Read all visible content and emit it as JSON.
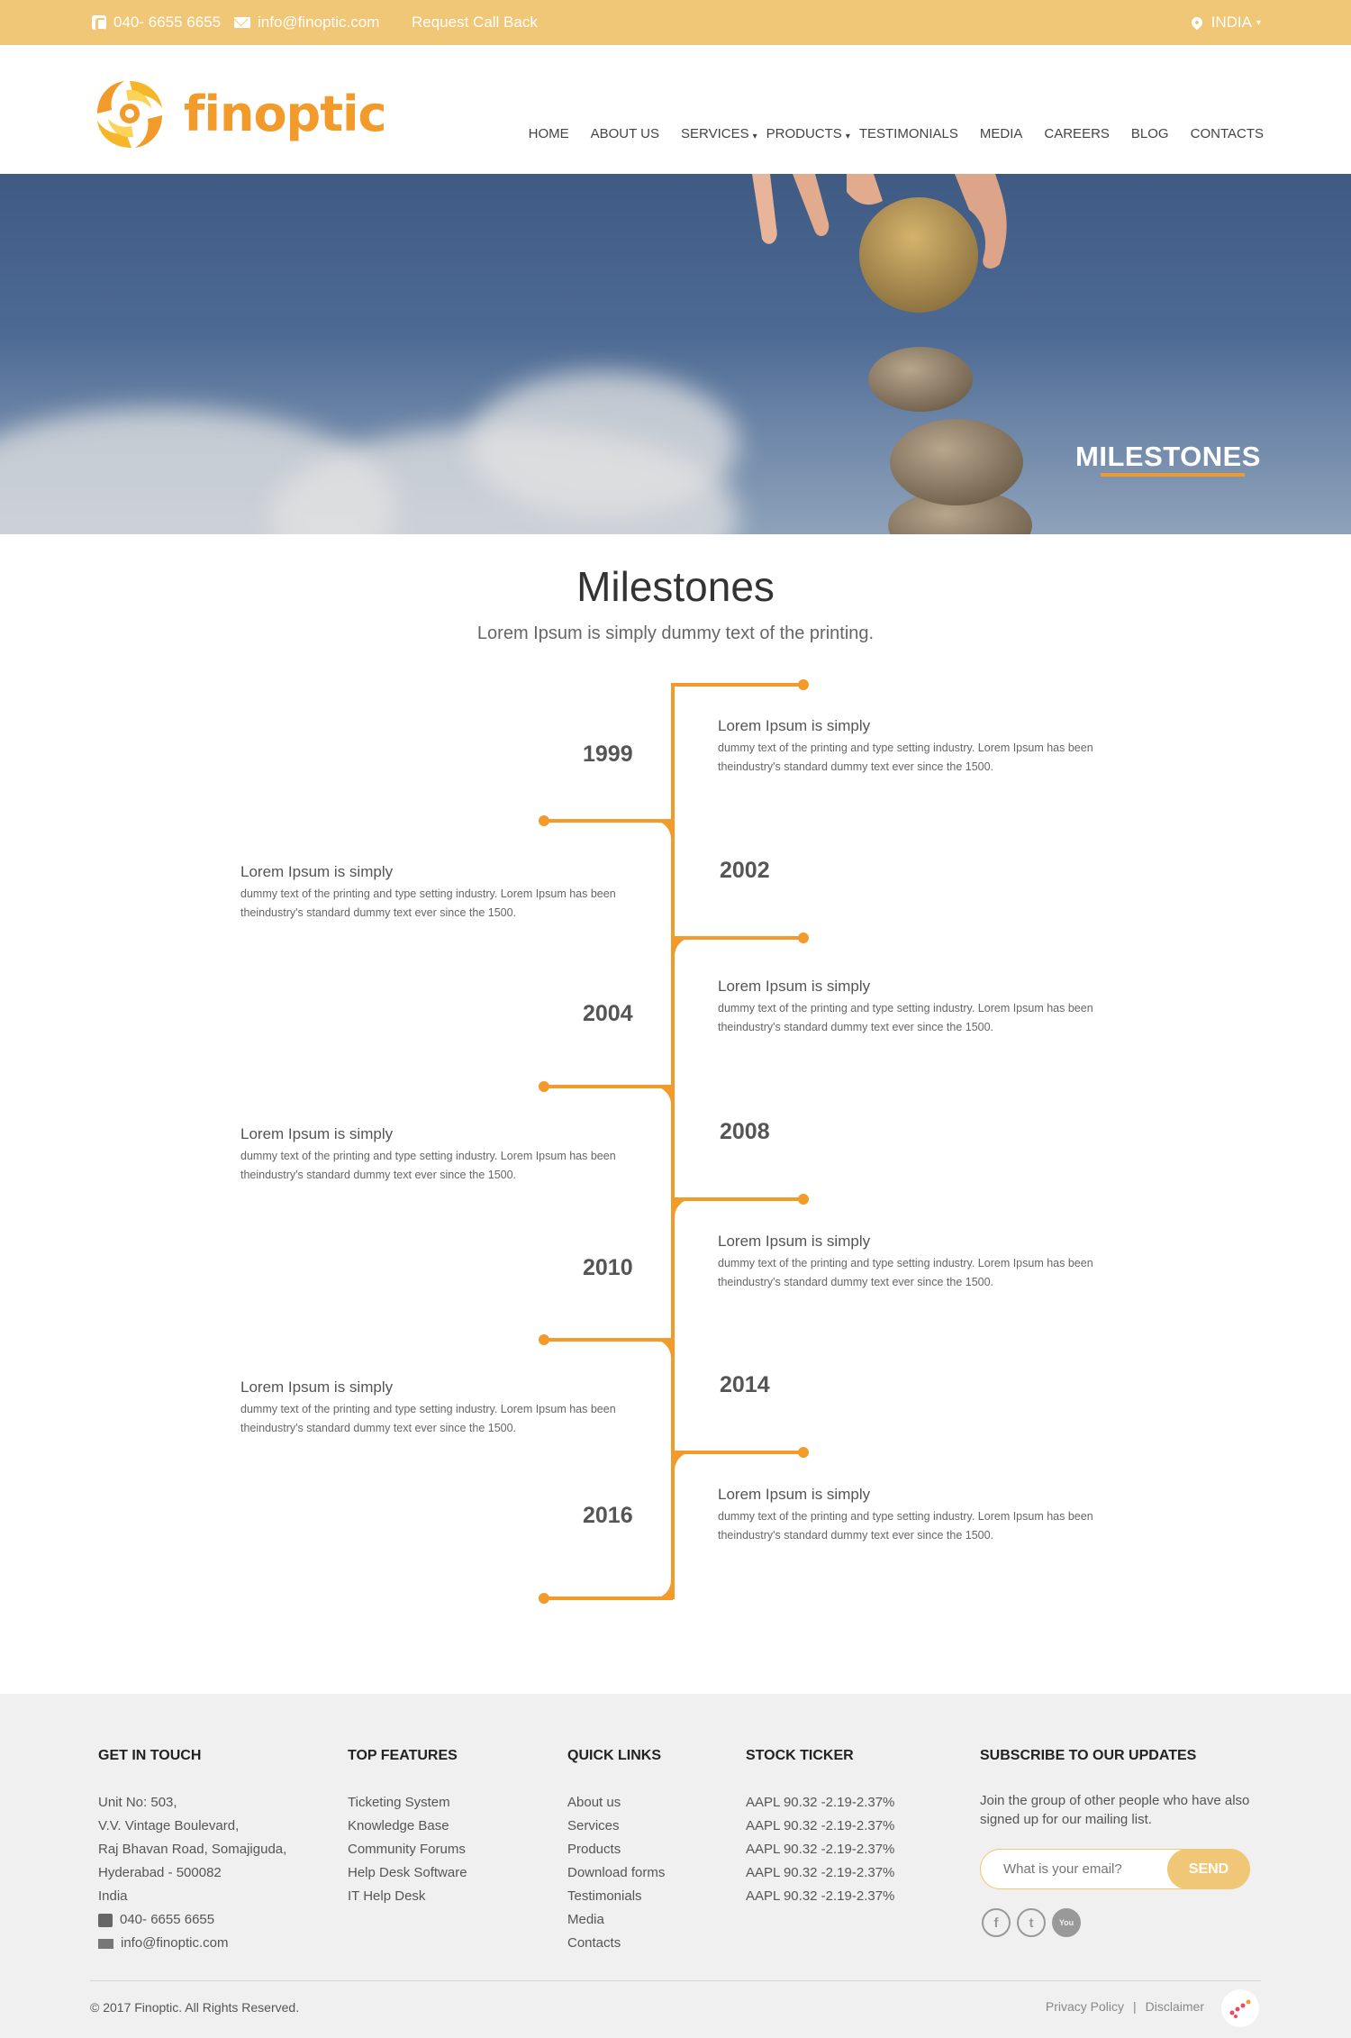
{
  "topbar": {
    "phone": "040- 6655 6655",
    "email": "info@finoptic.com",
    "callback": "Request Call Back",
    "country": "INDIA"
  },
  "brand": {
    "name": "finoptic",
    "accent": "#f29a2a",
    "topbar_color": "#f0c776"
  },
  "nav": {
    "items": [
      {
        "label": "HOME"
      },
      {
        "label": "ABOUT US"
      },
      {
        "label": "SERVICES"
      },
      {
        "label": "PRODUCTS"
      },
      {
        "label": "TESTIMONIALS"
      },
      {
        "label": "MEDIA"
      },
      {
        "label": "CAREERS"
      },
      {
        "label": "BLOG"
      },
      {
        "label": "CONTACTS"
      }
    ]
  },
  "hero": {
    "title": "MILESTONES"
  },
  "milestones": {
    "title": "Milestones",
    "subtitle": "Lorem Ipsum is simply dummy text of the printing.",
    "items": [
      {
        "year": "1999",
        "heading": "Lorem Ipsum is simply",
        "body": "dummy text of the printing and type setting    industry. Lorem  Ipsum  has been theindustry's standard dummy text ever since the 1500."
      },
      {
        "year": "2002",
        "heading": "Lorem Ipsum is simply",
        "body": "dummy text of the printing and type setting    industry. Lorem  Ipsum  has been theindustry's standard dummy text ever since the 1500."
      },
      {
        "year": "2004",
        "heading": "Lorem Ipsum is simply",
        "body": "dummy text of the printing and type setting    industry. Lorem  Ipsum  has been theindustry's standard dummy text ever since the 1500."
      },
      {
        "year": "2008",
        "heading": "Lorem Ipsum is simply",
        "body": "dummy text of the printing and type setting    industry. Lorem  Ipsum  has been theindustry's standard dummy text ever since the 1500."
      },
      {
        "year": "2010",
        "heading": "Lorem Ipsum is simply",
        "body": "dummy text of the printing and type setting    industry. Lorem  Ipsum  has been theindustry's standard dummy text ever since the 1500."
      },
      {
        "year": "2014",
        "heading": "Lorem Ipsum is simply",
        "body": "dummy text of the printing and type setting    industry. Lorem  Ipsum  has been theindustry's standard dummy text ever since the 1500."
      },
      {
        "year": "2016",
        "heading": "Lorem Ipsum is simply",
        "body": "dummy text of the printing and type setting    industry. Lorem  Ipsum  has been theindustry's standard dummy text ever since the 1500."
      }
    ]
  },
  "footer": {
    "touch": {
      "title": "GET IN TOUCH",
      "address": [
        "Unit No: 503,",
        "V.V. Vintage Boulevard,",
        "Raj Bhavan Road, Somajiguda,",
        "Hyderabad - 500082",
        "India"
      ],
      "phone": "040- 6655 6655",
      "email": "info@finoptic.com"
    },
    "features": {
      "title": "TOP FEATURES",
      "items": [
        "Ticketing System",
        "Knowledge Base",
        "Community Forums",
        "Help Desk Software",
        "IT Help Desk"
      ]
    },
    "quick": {
      "title": "QUICK LINKS",
      "items": [
        "About us",
        "Services",
        "Products",
        "Download forms",
        "Testimonials",
        "Media",
        "Contacts"
      ]
    },
    "stock": {
      "title": "STOCK TICKER",
      "items": [
        "AAPL 90.32 -2.19-2.37%",
        "AAPL 90.32 -2.19-2.37%",
        "AAPL 90.32 -2.19-2.37%",
        "AAPL 90.32 -2.19-2.37%",
        "AAPL 90.32 -2.19-2.37%"
      ]
    },
    "subscribe": {
      "title": "SUBSCRIBE TO OUR UPDATES",
      "text": "Join the group of other people who have also signed up for our mailing list.",
      "placeholder": "What is your email?",
      "button": "SEND"
    },
    "socials": [
      {
        "icon": "facebook-icon",
        "glyph": "f"
      },
      {
        "icon": "twitter-icon",
        "glyph": "t"
      },
      {
        "icon": "youtube-icon",
        "glyph": "You"
      }
    ],
    "copyright": "© 2017 Finoptic. All Rights Reserved.",
    "legal": {
      "privacy": "Privacy Policy",
      "separator": "|",
      "disclaimer": "Disclaimer"
    }
  }
}
